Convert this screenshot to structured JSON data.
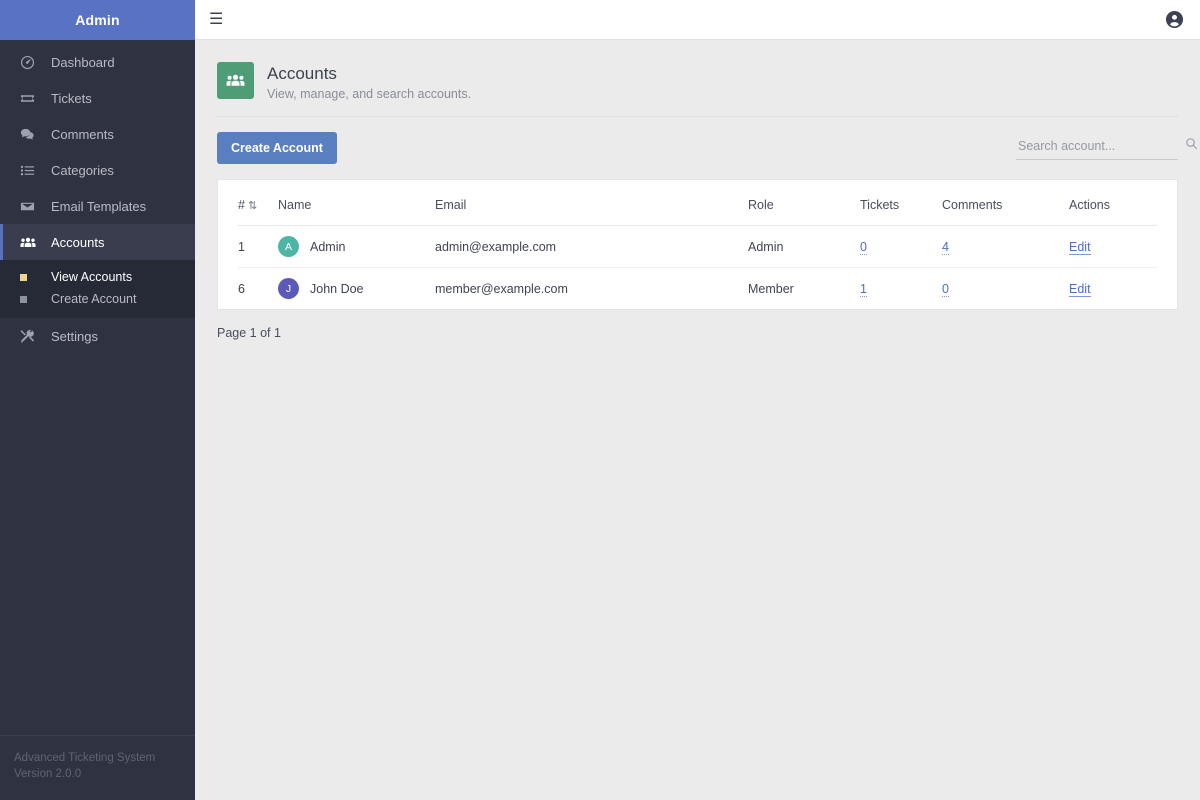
{
  "sidebar": {
    "brand": "Admin",
    "items": [
      {
        "label": "Dashboard",
        "icon": "dashboard-icon"
      },
      {
        "label": "Tickets",
        "icon": "ticket-icon"
      },
      {
        "label": "Comments",
        "icon": "comments-icon"
      },
      {
        "label": "Categories",
        "icon": "list-icon"
      },
      {
        "label": "Email Templates",
        "icon": "envelope-icon"
      },
      {
        "label": "Accounts",
        "icon": "users-icon"
      },
      {
        "label": "Settings",
        "icon": "tools-icon"
      }
    ],
    "submenu": [
      {
        "label": "View Accounts"
      },
      {
        "label": "Create Account"
      }
    ],
    "footer": {
      "app_name": "Advanced Ticketing System",
      "version": "Version 2.0.0"
    }
  },
  "topbar": {
    "menu_toggle_icon": "hamburger-icon",
    "menu_toggle_glyph": "☰",
    "user_icon": "user-circle-icon"
  },
  "page": {
    "icon": "users-icon",
    "title": "Accounts",
    "subtitle": "View, manage, and search accounts."
  },
  "toolbar": {
    "create_label": "Create Account",
    "search_placeholder": "Search account...",
    "search_value": "",
    "search_icon": "search-icon"
  },
  "table": {
    "columns": [
      "#",
      "Name",
      "Email",
      "Role",
      "Tickets",
      "Comments",
      "Actions"
    ],
    "sort_glyph": "⇅",
    "rows": [
      {
        "id": "1",
        "initial": "A",
        "avatar_color": "#4cb5a5",
        "name": "Admin",
        "email": "admin@example.com",
        "role": "Admin",
        "tickets": "0",
        "comments": "4",
        "action": "Edit"
      },
      {
        "id": "6",
        "initial": "J",
        "avatar_color": "#5c5ab8",
        "name": "John Doe",
        "email": "member@example.com",
        "role": "Member",
        "tickets": "1",
        "comments": "0",
        "action": "Edit"
      }
    ]
  },
  "pagination": {
    "text": "Page 1 of 1"
  },
  "colors": {
    "brand_blue": "#5a72c4",
    "sidebar_bg": "#2f3241",
    "submenu_bg": "#262936",
    "button_blue": "#5a7fc0",
    "page_icon_green": "#4f9d77",
    "link_blue": "#4a6fc7",
    "content_bg": "#ebebeb"
  }
}
